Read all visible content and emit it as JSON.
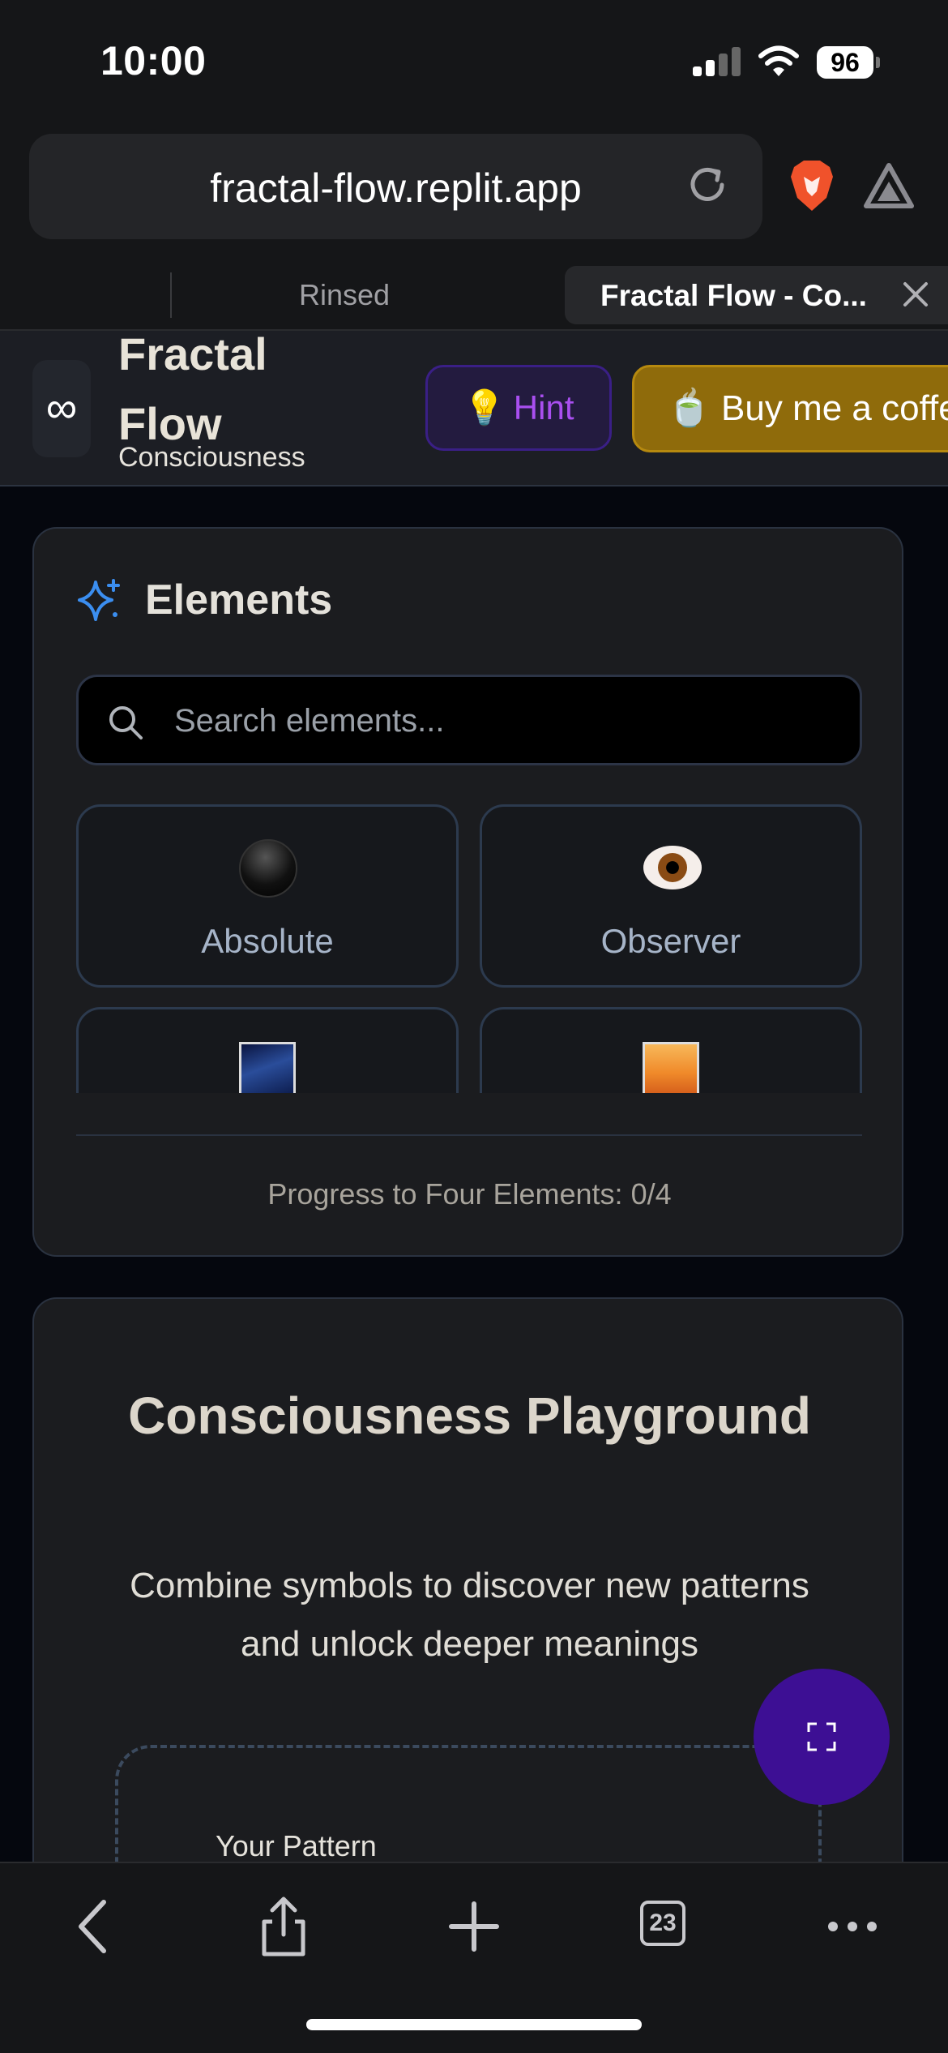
{
  "status": {
    "time": "10:00",
    "battery": "96"
  },
  "browser": {
    "url": "fractal-flow.replit.app",
    "tabs": [
      {
        "label": "Rinsed",
        "active": false
      },
      {
        "label": "Fractal Flow - Co...",
        "active": true
      }
    ],
    "tab_count": "23"
  },
  "header": {
    "logo_symbol": "∞",
    "title": "Fractal Flow",
    "subtitle": "Consciousness Discovery Game",
    "hint_icon": "💡",
    "hint_label": "Hint",
    "coffee_icon": "🍵",
    "coffee_label": "Buy me a coffee"
  },
  "elements": {
    "title": "Elements",
    "search_placeholder": "Search elements...",
    "items": [
      {
        "label": "Absolute",
        "icon": "black-orb-icon"
      },
      {
        "label": "Observer",
        "icon": "eye-icon"
      },
      {
        "label": "",
        "icon": "milky-way-icon"
      },
      {
        "label": "",
        "icon": "sunrise-icon"
      }
    ],
    "progress_text": "Progress to Four Elements: 0/4"
  },
  "playground": {
    "title": "Consciousness Playground",
    "subtitle": "Combine symbols to discover new patterns and unlock deeper meanings",
    "pattern_label": "Your Pattern"
  },
  "colors": {
    "accent_purple": "#3d0f94",
    "hint_text": "#a94ff0",
    "coffee_bg": "#8f6b0b",
    "sparkle_blue": "#3b8ef0"
  }
}
